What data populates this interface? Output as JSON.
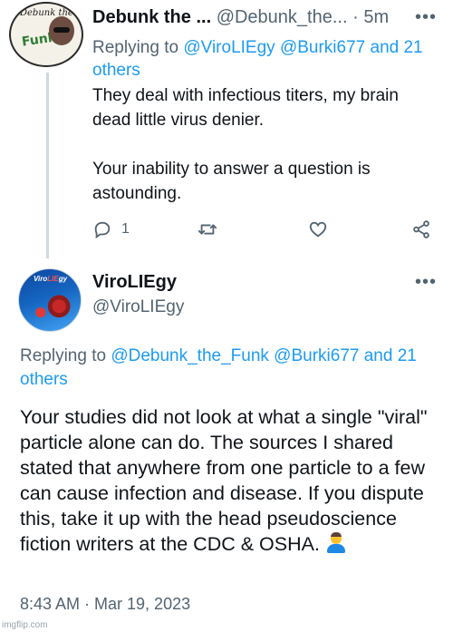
{
  "tweet1": {
    "name": "Debunk the ...",
    "handle": "@Debunk_the...",
    "dot": "·",
    "time": "5m",
    "more": "•••",
    "replying_prefix": "Replying to",
    "replying_mentions": "@ViroLIEgy @Burki677 and 21 others",
    "avatar_text_top": "Debunk the",
    "avatar_text_funk": "Funk",
    "body": "They deal with infectious titers, my brain dead little virus denier.\n\nYour inability to answer a question is astounding.",
    "reply_count": "1",
    "icons": {
      "reply": "reply-icon",
      "retweet": "retweet-icon",
      "like": "like-icon",
      "share": "share-icon"
    }
  },
  "tweet2": {
    "name": "ViroLIEgy",
    "handle": "@ViroLIEgy",
    "more": "•••",
    "avatar_text_a": "Viro",
    "avatar_text_b": "LIE",
    "avatar_text_c": "gy",
    "replying_prefix": "Replying to",
    "replying_mentions": "@Debunk_the_Funk @Burki677 and 21 others",
    "body": "Your studies did not look at what a single \"viral\" particle alone can do. The sources I shared stated that anywhere from one particle to a few can cause infection and disease. If you dispute this, take it up with the head pseudoscience fiction writers at the CDC & OSHA.",
    "emoji": "man-shrugging-emoji",
    "timestamp": "8:43 AM · Mar 19, 2023"
  },
  "watermark": "imgflip.com",
  "colors": {
    "text": "#0f1419",
    "secondary": "#536471",
    "link": "#1d9bf0",
    "thread_line": "#cfd9de"
  }
}
